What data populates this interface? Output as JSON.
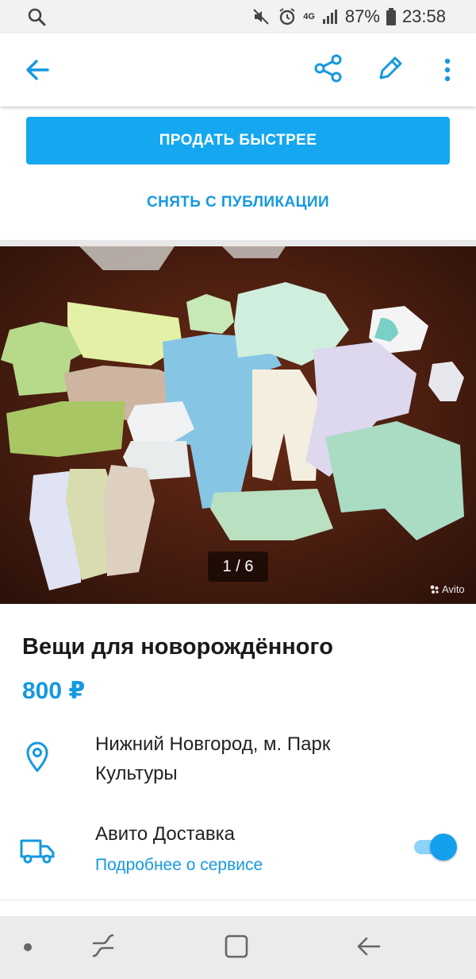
{
  "status_bar": {
    "battery": "87%",
    "time": "23:58",
    "network": "4G"
  },
  "actions": {
    "sell_faster": "ПРОДАТЬ БЫСТРЕЕ",
    "unpublish": "СНЯТЬ С ПУБЛИКАЦИИ"
  },
  "gallery": {
    "counter": "1 / 6",
    "watermark": "Avito"
  },
  "listing": {
    "title": "Вещи для новорождённого",
    "price": "800 ₽",
    "location": "Нижний Новгород, м. Парк Культуры"
  },
  "delivery": {
    "title": "Авито Доставка",
    "link": "Подробнее о сервисе",
    "enabled": true
  },
  "colors": {
    "accent": "#15a8f0",
    "link": "#1599e0"
  },
  "icons": [
    "search-icon",
    "mute-icon",
    "alarm-icon",
    "signal-icon",
    "battery-icon",
    "back-arrow-icon",
    "share-icon",
    "edit-pencil-icon",
    "more-vert-icon",
    "location-pin-icon",
    "truck-icon",
    "nav-dot-icon",
    "nav-recent-icon",
    "nav-home-icon",
    "nav-back-icon"
  ]
}
